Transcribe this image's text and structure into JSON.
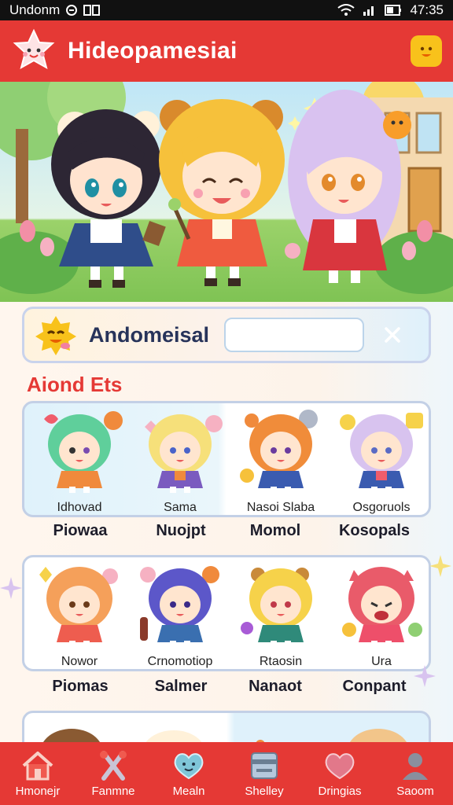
{
  "status_bar": {
    "carrier": "Undonm",
    "time": "47:35"
  },
  "header": {
    "title": "Hideopamesiai"
  },
  "search": {
    "label": "Andomeisal",
    "value": "",
    "placeholder": ""
  },
  "section": {
    "title": "Aiond Ets"
  },
  "row1": {
    "chars": [
      {
        "name": "Idhovad",
        "hair": "#5fcf9b",
        "outfit": "#f08a3c"
      },
      {
        "name": "Sama",
        "hair": "#f6e07a",
        "outfit": "#7a5bbf"
      },
      {
        "name": "Nasoi Slaba",
        "hair": "#f08c3a",
        "outfit": "#3a5bb0"
      },
      {
        "name": "Osgoruols",
        "hair": "#d8c3ef",
        "outfit": "#3a5bb0"
      }
    ],
    "labels": [
      "Piowaa",
      "Nuojpt",
      "Momol",
      "Kosopals"
    ]
  },
  "row2": {
    "chars": [
      {
        "name": "Nowor",
        "hair": "#f5a05a",
        "outfit": "#ee5d4f"
      },
      {
        "name": "Crnomotiop",
        "hair": "#5c57c9",
        "outfit": "#3a6fb0"
      },
      {
        "name": "Rtaosin",
        "hair": "#f6d24a",
        "outfit": "#2f8a7a"
      },
      {
        "name": "Ura",
        "hair": "#e95b6a",
        "outfit": "#ee4f6a"
      }
    ],
    "labels": [
      "Piomas",
      "Salmer",
      "Nanaot",
      "Conpant"
    ]
  },
  "nav": [
    {
      "label": "Hmonejr",
      "icon": "home-icon"
    },
    {
      "label": "Fanmne",
      "icon": "tools-icon"
    },
    {
      "label": "Mealn",
      "icon": "heart-bubble-icon"
    },
    {
      "label": "Shelley",
      "icon": "wallet-icon"
    },
    {
      "label": "Dringias",
      "icon": "heart-icon"
    },
    {
      "label": "Saoom",
      "icon": "profile-icon"
    }
  ],
  "colors": {
    "primary": "#e53935",
    "accent": "#f8c21b",
    "card_border": "#c3d0e6"
  }
}
